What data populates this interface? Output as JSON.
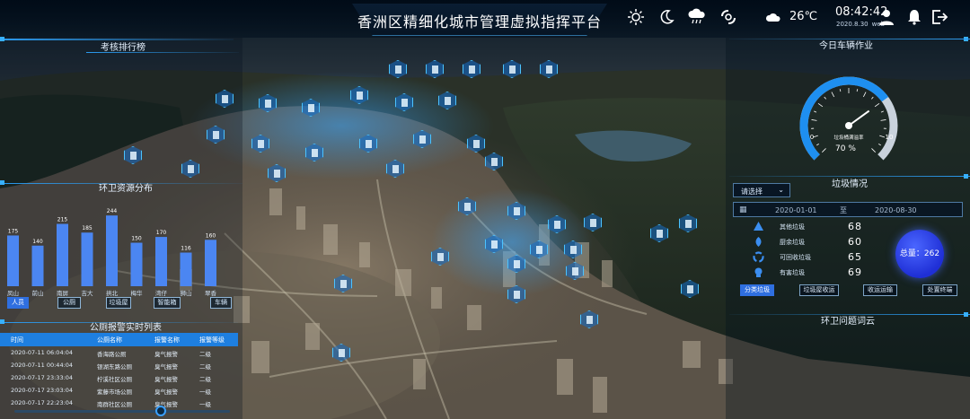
{
  "header": {
    "title": "香洲区精细化城市管理虚拟指挥平台",
    "temperature": "26℃",
    "time": "08:42:42",
    "date": "2020.8.30",
    "weekday": "web"
  },
  "icons": {
    "sun": "sun-icon",
    "moon": "moon-icon",
    "rain": "rain-cloud-icon",
    "typhoon": "typhoon-icon",
    "cloud": "cloud-icon",
    "user": "user-icon",
    "bell": "bell-icon",
    "logout": "logout-icon"
  },
  "panels": {
    "assessment": "考核排行榜",
    "resources": "环卫资源分布",
    "alarm_list": "公厕报警实时列表",
    "vehicles": "今日车辆作业",
    "garbage": "垃圾情况",
    "word_cloud": "环卫问题词云"
  },
  "chart_data": {
    "type": "bar",
    "title": "环卫资源分布",
    "categories": [
      "凤山",
      "前山",
      "南屏",
      "吉大",
      "拱北",
      "梅华",
      "湾仔",
      "狮山",
      "翠香"
    ],
    "values": [
      175,
      140,
      215,
      185,
      244,
      150,
      170,
      116,
      160
    ],
    "labels": [
      "175",
      "140",
      "215",
      "185",
      "244",
      "150",
      "170",
      "116",
      "160"
    ],
    "ylim": [
      0,
      260
    ],
    "color": "#4b86f2",
    "tabs": [
      "人员",
      "公厕",
      "垃圾屋",
      "智能箱",
      "车辆"
    ],
    "active_tab": 0
  },
  "alarm": {
    "headers": [
      "时间",
      "公厕名称",
      "报警名称",
      "报警等级"
    ],
    "rows": [
      [
        "2020-07-11 06:04:04",
        "香海路公厕",
        "臭气报警",
        "二级"
      ],
      [
        "2020-07-11 00:44:04",
        "银湖东路公厕",
        "臭气报警",
        "二级"
      ],
      [
        "2020-07-17 23:33:04",
        "柠溪社区公厕",
        "臭气报警",
        "二级"
      ],
      [
        "2020-07-17 23:03:04",
        "紫藤市场公厕",
        "臭气报警",
        "一级"
      ],
      [
        "2020-07-17 22:23:04",
        "南群社区公厕",
        "臭气报警",
        "一级"
      ]
    ]
  },
  "gauge": {
    "label": "垃圾桶满溢率",
    "min": "0",
    "max": "10",
    "ticks": [
      "0",
      "2",
      "4",
      "6",
      "8",
      "10"
    ],
    "value_fraction": 0.7,
    "percent": "70 %"
  },
  "garbage": {
    "select_label": "请选择",
    "date_start": "2020-01-01",
    "date_sep": "至",
    "date_end": "2020-08-30",
    "items": [
      {
        "label": "其他垃圾",
        "value": "68",
        "icon": "other-waste-icon"
      },
      {
        "label": "厨余垃圾",
        "value": "60",
        "icon": "kitchen-waste-icon"
      },
      {
        "label": "可回收垃圾",
        "value": "65",
        "icon": "recycle-icon"
      },
      {
        "label": "有害垃圾",
        "value": "69",
        "icon": "hazardous-waste-icon"
      }
    ],
    "total": "总量：262",
    "buttons": [
      "分类垃圾",
      "垃圾屋收运",
      "收运运输",
      "处置终端"
    ],
    "active_button": 0
  }
}
